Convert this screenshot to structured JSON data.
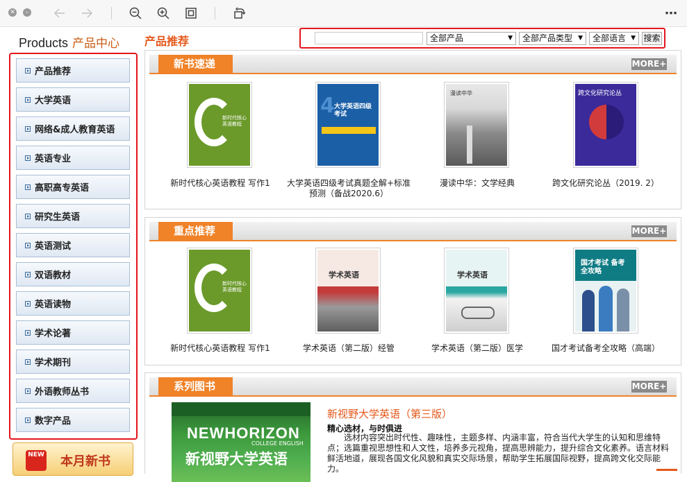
{
  "toolbar": {
    "close_icon": "close-icon",
    "minimize_icon": "minimize-icon",
    "back_icon": "back-arrow-icon",
    "forward_icon": "forward-arrow-icon",
    "zoom_out_icon": "zoom-out-icon",
    "zoom_in_icon": "zoom-in-icon",
    "fit_icon": "fit-screen-icon",
    "rotate_icon": "rotate-icon",
    "more_label": "⋯"
  },
  "sidebar": {
    "title_en": "Products",
    "title_cn": "产品中心",
    "items": [
      {
        "label": "产品推荐"
      },
      {
        "label": "大学英语"
      },
      {
        "label": "网络&成人教育英语"
      },
      {
        "label": "英语专业"
      },
      {
        "label": "高职高专英语"
      },
      {
        "label": "研究生英语"
      },
      {
        "label": "英语测试"
      },
      {
        "label": "双语教材"
      },
      {
        "label": "英语读物"
      },
      {
        "label": "学术论著"
      },
      {
        "label": "学术期刊"
      },
      {
        "label": "外语教师丛书"
      },
      {
        "label": "数字产品"
      }
    ],
    "new_books_icon": "NEW",
    "new_books_label": "本月新书"
  },
  "header": {
    "title": "产品推荐",
    "search_value": "",
    "select_product": "全部产品",
    "select_type": "全部产品类型",
    "select_language": "全部语言",
    "search_button": "搜索"
  },
  "sections": {
    "new": {
      "label": "新书速递",
      "more": "MORE+",
      "books": [
        {
          "title": "新时代核心英语教程 写作1",
          "cover": "新时代核心英语教程"
        },
        {
          "title": "大学英语四级考试真题全解+标准预测（备战2020.6）",
          "cover": "大学英语四级考试"
        },
        {
          "title": "漫读中华：文学经典",
          "cover": "漫读中华"
        },
        {
          "title": "跨文化研究论丛（2019. 2）",
          "cover": "跨文化研究论丛"
        }
      ]
    },
    "featured": {
      "label": "重点推荐",
      "more": "MORE+",
      "books": [
        {
          "title": "新时代核心英语教程 写作1",
          "cover": "新时代核心英语教程"
        },
        {
          "title": "学术英语（第二版）经管",
          "cover": "学术英语"
        },
        {
          "title": "学术英语（第二版）医学",
          "cover": "学术英语"
        },
        {
          "title": "国才考试备考全攻略（高端）",
          "cover": "国才考试 备考全攻略"
        }
      ]
    },
    "series": {
      "label": "系列图书",
      "more": "MORE+",
      "image_brand": "NEWHORIZON",
      "image_sub": "COLLEGE ENGLISH",
      "image_cn": "新视野大学英语",
      "title": "新视野大学英语（第三版）",
      "subtitle": "精心选材，与时俱进",
      "description": "选材内容突出时代性、趣味性，主题多样、内涵丰富，符合当代大学生的认知和思维特点；选篇重视思想性和人文性，培养多元视角，提高思辨能力，提升综合文化素养。语言材料鲜活地道，展现各国文化风貌和真实交际场景，帮助学生拓展国际视野，提高跨文化交际能力。"
    }
  }
}
